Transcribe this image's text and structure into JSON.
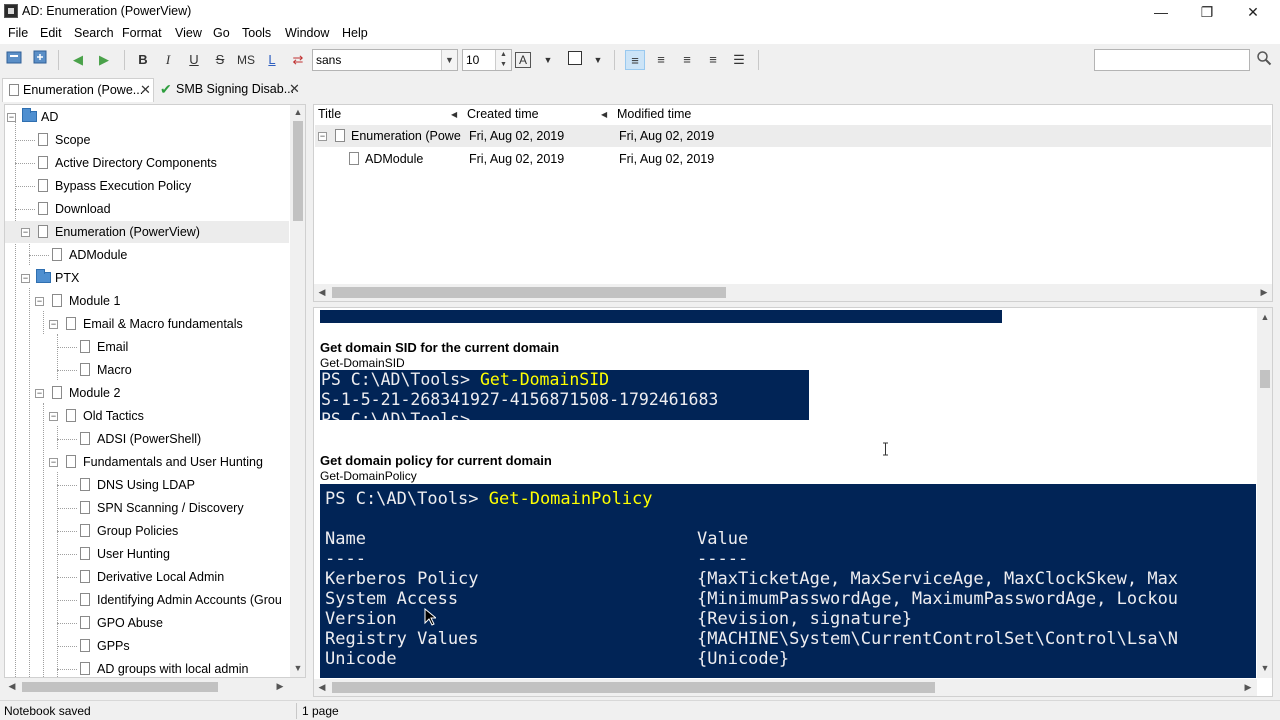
{
  "window": {
    "title": "AD: Enumeration (PowerView)",
    "controls": [
      "—",
      "❐",
      "✕"
    ]
  },
  "menu": [
    "File",
    "Edit",
    "Search",
    "Format",
    "View",
    "Go",
    "Tools",
    "Window",
    "Help"
  ],
  "toolbar": {
    "bold": "B",
    "italic": "I",
    "underline": "U",
    "strike": "S",
    "mono": "MS",
    "link": "L",
    "font_name": "sans",
    "font_size": "10",
    "text_color": "A",
    "search_value": ""
  },
  "tabs": [
    {
      "label": "Enumeration (Powe..."
    },
    {
      "label": "SMB Signing Disab..."
    }
  ],
  "tree": [
    {
      "label": "AD"
    },
    {
      "label": "Scope"
    },
    {
      "label": "Active Directory Components"
    },
    {
      "label": "Bypass Execution Policy"
    },
    {
      "label": "Download"
    },
    {
      "label": "Enumeration (PowerView)"
    },
    {
      "label": "ADModule"
    },
    {
      "label": "PTX"
    },
    {
      "label": "Module 1"
    },
    {
      "label": "Email & Macro fundamentals"
    },
    {
      "label": "Email"
    },
    {
      "label": "Macro"
    },
    {
      "label": "Module 2"
    },
    {
      "label": "Old Tactics"
    },
    {
      "label": "ADSI (PowerShell)"
    },
    {
      "label": "Fundamentals and User Hunting"
    },
    {
      "label": "DNS Using LDAP"
    },
    {
      "label": "SPN Scanning / Discovery"
    },
    {
      "label": "Group Policies"
    },
    {
      "label": "User Hunting"
    },
    {
      "label": "Derivative Local Admin"
    },
    {
      "label": "Identifying Admin Accounts (Grou"
    },
    {
      "label": "GPO Abuse"
    },
    {
      "label": "GPPs"
    },
    {
      "label": "AD groups with local admin"
    }
  ],
  "list": {
    "headers": [
      "Title",
      "Created time",
      "Modified time"
    ],
    "rows": [
      {
        "title": "Enumeration (Powe",
        "created": "Fri, Aug 02, 2019",
        "modified": "Fri, Aug 02, 2019"
      },
      {
        "title": "ADModule",
        "created": "Fri, Aug 02, 2019",
        "modified": "Fri, Aug 02, 2019"
      }
    ]
  },
  "editor": {
    "section1": {
      "heading": "Get domain SID for the current domain",
      "command": "Get-DomainSID",
      "ps_prompt": "PS C:\\AD\\Tools> ",
      "ps_cmd": "Get-DomainSID",
      "ps_output": "S-1-5-21-268341927-4156871508-1792461683",
      "ps_cut": "PS C:\\AD\\Tools>"
    },
    "section2": {
      "heading": "Get domain policy for current domain",
      "command": "Get-DomainPolicy",
      "ps_prompt": "PS C:\\AD\\Tools> ",
      "ps_cmd": "Get-DomainPolicy",
      "col_name": "Name",
      "col_value": "Value",
      "dash_name": "----",
      "dash_value": "-----",
      "rows": [
        {
          "name": "Kerberos Policy",
          "value": "{MaxTicketAge, MaxServiceAge, MaxClockSkew, Max"
        },
        {
          "name": "System Access",
          "value": "{MinimumPasswordAge, MaximumPasswordAge, Lockou"
        },
        {
          "name": "Version",
          "value": "{Revision, signature}"
        },
        {
          "name": "Registry Values",
          "value": "{MACHINE\\System\\CurrentControlSet\\Control\\Lsa\\N"
        },
        {
          "name": "Unicode",
          "value": "{Unicode}"
        }
      ]
    }
  },
  "status": {
    "left": "Notebook saved",
    "right": "1 page"
  }
}
